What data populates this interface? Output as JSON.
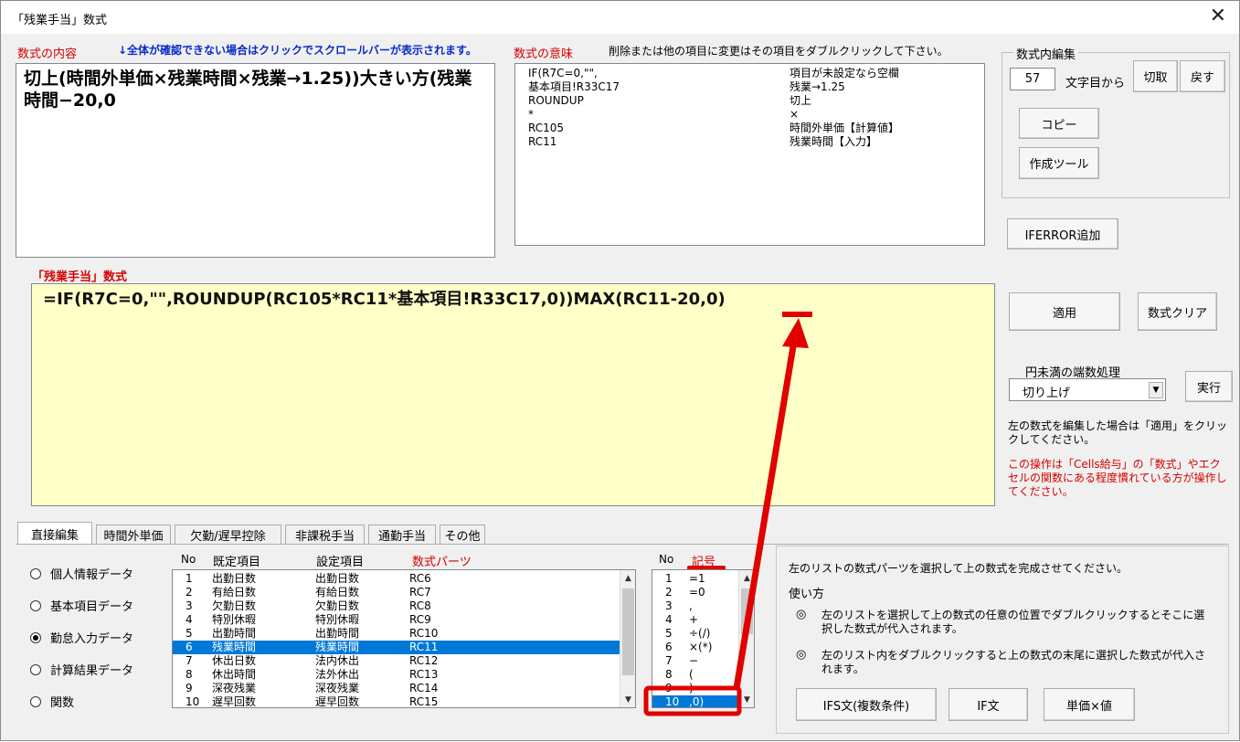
{
  "window": {
    "title": "「残業手当」数式",
    "close": "✕"
  },
  "content": {
    "label": "数式の内容",
    "hint": "↓全体が確認できない場合はクリックでスクロールバーが表示されます。",
    "text": "切上(時間外単価×残業時間×残業→1.25))大きい方(残業時間−20,0"
  },
  "meaning": {
    "label": "数式の意味",
    "hint": "削除または他の項目に変更はその項目をダブルクリックして下さい。",
    "rows": [
      [
        "IF(R7C=0,\"\",",
        "項目が未設定なら空欄"
      ],
      [
        "基本項目!R33C17",
        "残業→1.25"
      ],
      [
        "ROUNDUP",
        "切上"
      ],
      [
        "*",
        "×"
      ],
      [
        "RC105",
        "時間外単価【計算値】"
      ],
      [
        "RC11",
        "残業時間【入力】"
      ]
    ]
  },
  "edit": {
    "group_label": "数式内編集",
    "pos_value": "57",
    "pos_suffix": "文字目から",
    "cut": "切取",
    "undo": "戻す",
    "copy": "コピー",
    "tool": "作成ツール"
  },
  "iferror": "IFERROR追加",
  "formula": {
    "label": "「残業手当」数式",
    "text": "=IF(R7C=0,\"\",ROUNDUP(RC105*RC11*基本項目!R33C17,0))MAX(RC11-20,0)"
  },
  "apply": "適用",
  "clear": "数式クリア",
  "rounding": {
    "label": "円未満の端数処理",
    "selected": "切り上げ",
    "run": "実行"
  },
  "notes": {
    "note1": "左の数式を編集した場合は「適用」をクリックしてください。",
    "note2": "この操作は「Cells給与」の「数式」やエクセルの関数にある程度慣れている方が操作してください。"
  },
  "tabs": [
    "直接編集",
    "時間外単価",
    "欠勤/遅早控除",
    "非課税手当",
    "通勤手当",
    "その他"
  ],
  "radios": [
    "個人情報データ",
    "基本項目データ",
    "勤怠入力データ",
    "計算結果データ",
    "関数"
  ],
  "radio_selected_index": 2,
  "parts": {
    "headers": {
      "no": "No",
      "default": "既定項目",
      "setting": "設定項目",
      "part": "数式パーツ"
    },
    "rows": [
      [
        "1",
        "出勤日数",
        "出勤日数",
        "RC6"
      ],
      [
        "2",
        "有給日数",
        "有給日数",
        "RC7"
      ],
      [
        "3",
        "欠勤日数",
        "欠勤日数",
        "RC8"
      ],
      [
        "4",
        "特別休暇",
        "特別休暇",
        "RC9"
      ],
      [
        "5",
        "出勤時間",
        "出勤時間",
        "RC10"
      ],
      [
        "6",
        "残業時間",
        "残業時間",
        "RC11"
      ],
      [
        "7",
        "休出日数",
        "法内休出",
        "RC12"
      ],
      [
        "8",
        "休出時間",
        "法外休出",
        "RC13"
      ],
      [
        "9",
        "深夜残業",
        "深夜残業",
        "RC14"
      ],
      [
        "10",
        "遅早回数",
        "遅早回数",
        "RC15"
      ]
    ],
    "selected_index": 5
  },
  "symbols": {
    "headers": {
      "no": "No",
      "symbol": "記号"
    },
    "rows": [
      [
        "1",
        "=1"
      ],
      [
        "2",
        "=0"
      ],
      [
        "3",
        ","
      ],
      [
        "4",
        "+"
      ],
      [
        "5",
        "÷(/)"
      ],
      [
        "6",
        "×(*)"
      ],
      [
        "7",
        "−"
      ],
      [
        "8",
        "("
      ],
      [
        "9",
        ")"
      ],
      [
        "10",
        ",0)"
      ]
    ],
    "selected_index": 9
  },
  "help": {
    "intro": "左のリストの数式パーツを選択して上の数式を完成させてください。",
    "howto": "使い方",
    "bullet": "◎",
    "item1": "左のリストを選択して上の数式の任意の位置でダブルクリックするとそこに選択した数式が代入されます。",
    "item2": "左のリスト内をダブルクリックすると上の数式の末尾に選択した数式が代入されます。"
  },
  "bottom_buttons": {
    "ifs": "IFS文(複数条件)",
    "if": "IF文",
    "unit": "単価×値"
  },
  "colors": {
    "formula_bg": "#ffffc8",
    "select": "#0078d7",
    "annotation": "#e00000",
    "label_red": "#d40000",
    "hint_blue": "#0a2cc7"
  }
}
